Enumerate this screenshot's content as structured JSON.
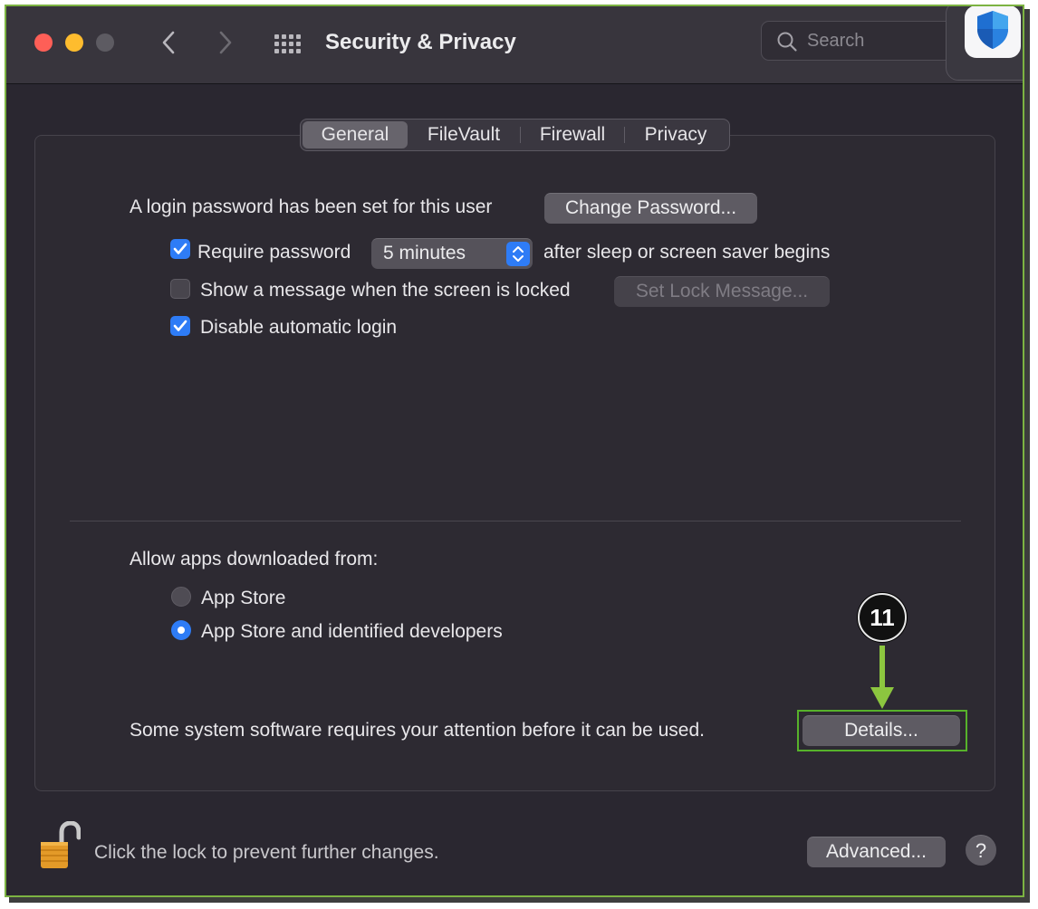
{
  "window": {
    "title": "Security & Privacy",
    "search_placeholder": "Search"
  },
  "colors": {
    "accent": "#2e7cf6",
    "highlight": "#57b22b",
    "arrow": "#8cc63f",
    "close": "#fe5f57",
    "minimize": "#febc2e",
    "inactive": "#5d5b62"
  },
  "tabs": [
    "General",
    "FileVault",
    "Firewall",
    "Privacy"
  ],
  "selected_tab": "General",
  "general": {
    "login_text": "A login password has been set for this user",
    "change_password": "Change Password...",
    "require_password": {
      "label": "Require password",
      "checked": true,
      "value": "5 minutes",
      "suffix": "after sleep or screen saver begins"
    },
    "show_message": {
      "label": "Show a message when the screen is locked",
      "checked": false,
      "button": "Set Lock Message..."
    },
    "disable_autologin": {
      "label": "Disable automatic login",
      "checked": true
    },
    "allow_apps_label": "Allow apps downloaded from:",
    "allow_options": [
      {
        "label": "App Store",
        "selected": false
      },
      {
        "label": "App Store and identified developers",
        "selected": true
      }
    ],
    "attention_text": "Some system software requires your attention before it can be used.",
    "details_button": "Details..."
  },
  "annotation": {
    "step": "11"
  },
  "footer": {
    "lock_text": "Click the lock to prevent further changes.",
    "advanced_button": "Advanced...",
    "help": "?"
  },
  "icons": [
    "back-chevron-icon",
    "forward-chevron-icon",
    "show-all-grid-icon",
    "search-icon",
    "defender-shield-icon",
    "unlocked-padlock-icon"
  ]
}
